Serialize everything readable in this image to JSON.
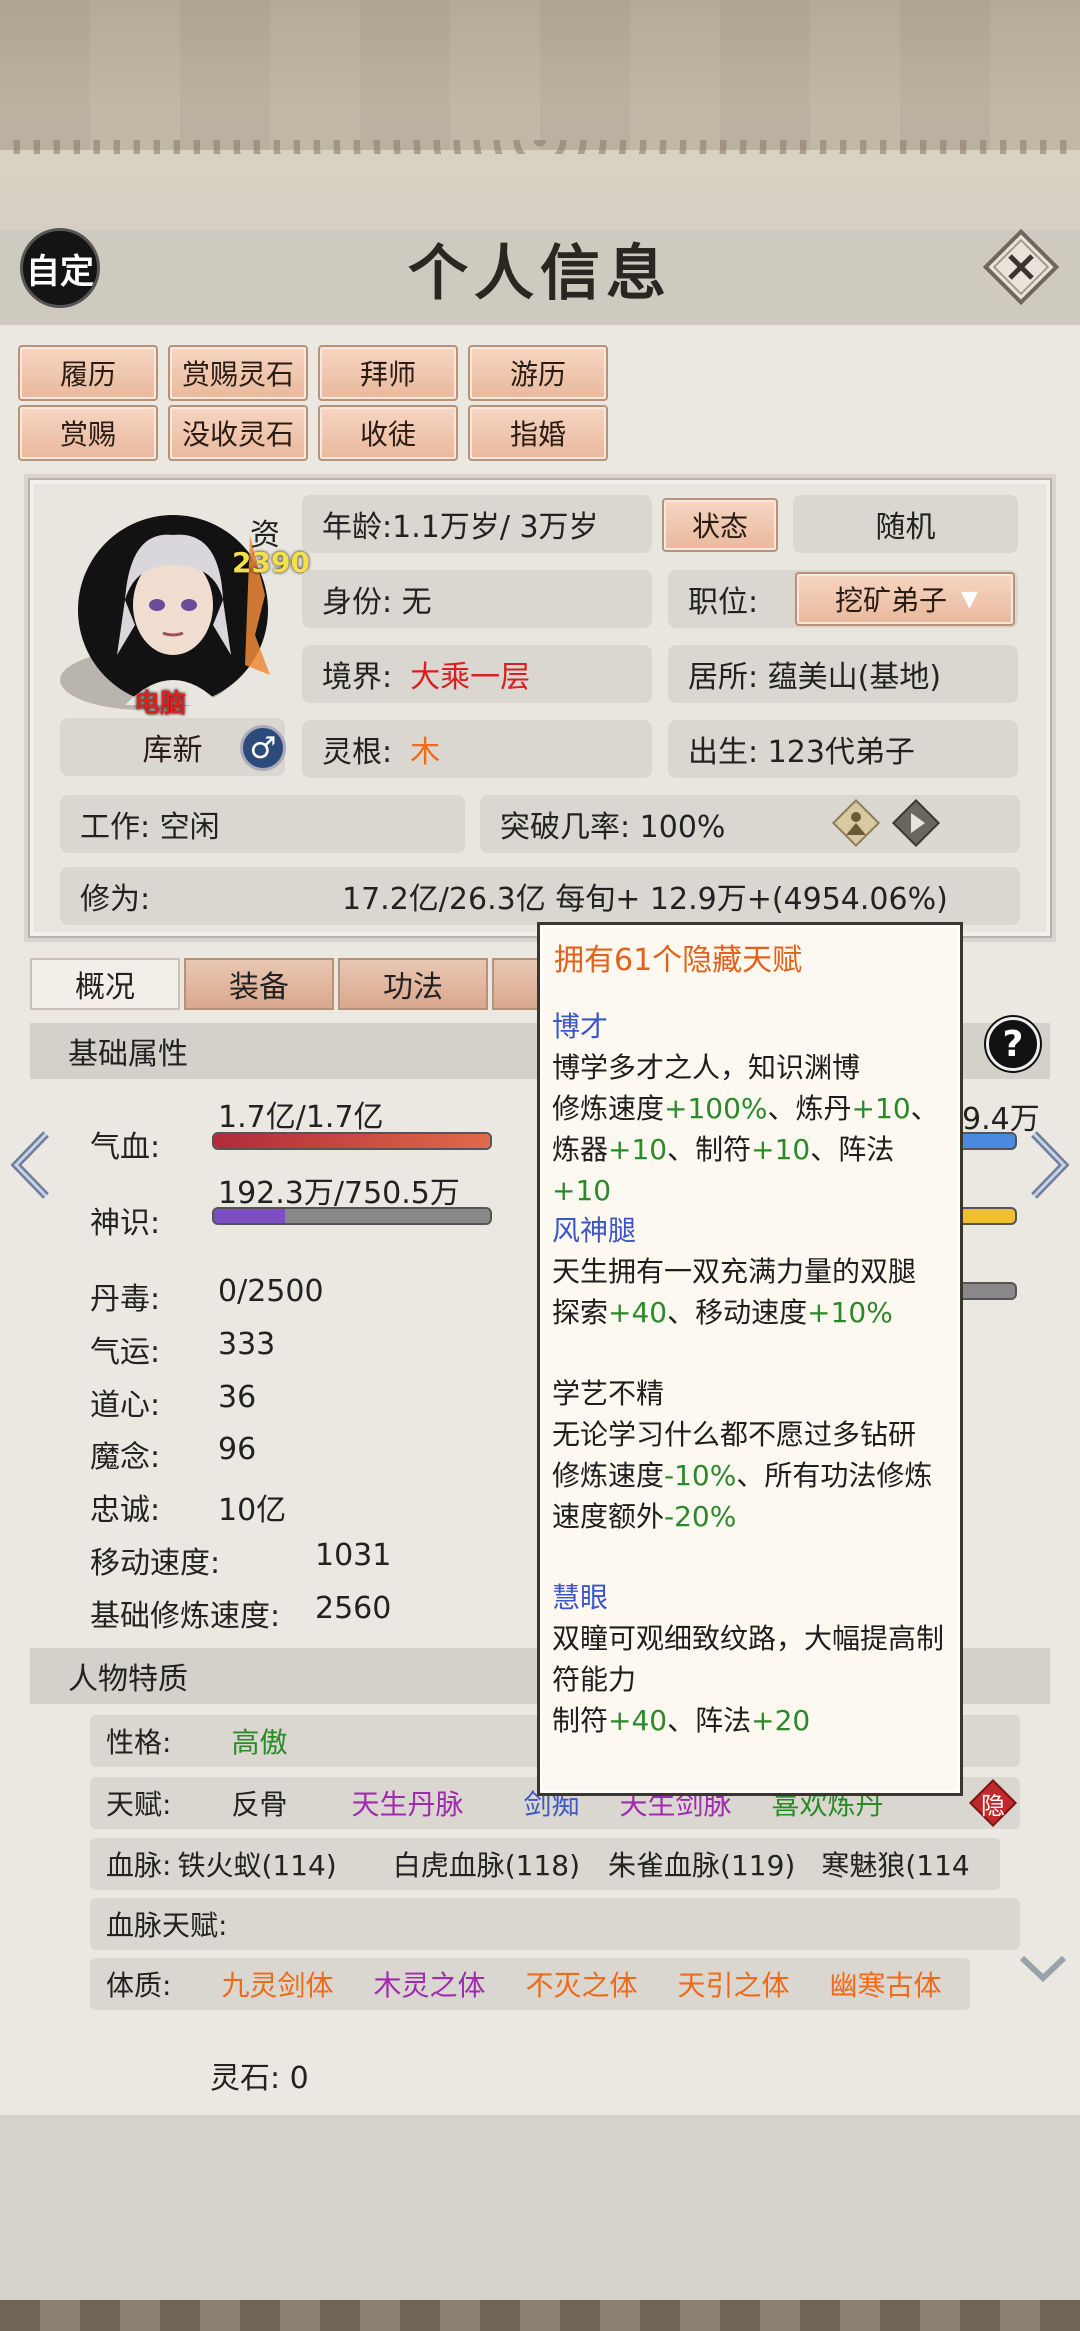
{
  "header": {
    "title": "个人信息",
    "self_label": "自定"
  },
  "actions": {
    "row1": [
      "履历",
      "赏赐灵石",
      "拜师",
      "游历"
    ],
    "row2": [
      "赏赐",
      "没收灵石",
      "收徒",
      "指婚"
    ]
  },
  "profile": {
    "aptitude_label": "资",
    "aptitude_value": "2390",
    "tag": "电脑",
    "name": "库新",
    "age": "年龄:1.1万岁/ 3万岁",
    "status_btn": "状态",
    "random_btn": "随机",
    "identity": "身份:  无",
    "position_label": "职位:",
    "position_value": "挖矿弟子",
    "realm_label": "境界:",
    "realm_value": "大乘一层",
    "residence": "居所: 蕴美山(基地)",
    "root_label": "灵根:",
    "root_value": "木",
    "birth": "出生:  123代弟子",
    "work": "工作: 空闲",
    "breakthrough": "突破几率:  100%",
    "cultivation_label": "修为:",
    "cultivation_value": "17.2亿/26.3亿   每旬+  12.9万+(4954.06%)"
  },
  "tabs": [
    "概况",
    "装备",
    "功法"
  ],
  "basic": {
    "heading": "基础属性",
    "hp_label": "气血:",
    "hp_value": "1.7亿/1.7亿",
    "hp_ratio": 1.0,
    "sense_label": "神识:",
    "sense_value": "192.3万/750.5万",
    "sense_ratio": 0.256,
    "right_value_partial": "9.4万",
    "stats": [
      {
        "label": "丹毒:",
        "value": "0/2500"
      },
      {
        "label": "气运:",
        "value": "333"
      },
      {
        "label": "道心:",
        "value": "36"
      },
      {
        "label": "魔念:",
        "value": "96"
      },
      {
        "label": "忠诚:",
        "value": "10亿"
      },
      {
        "label": "移动速度:",
        "value": "1031"
      },
      {
        "label": "基础修炼速度:",
        "value": "2560"
      }
    ]
  },
  "traits": {
    "heading": "人物特质",
    "personality_label": "性格:",
    "personality_value": "高傲",
    "talent_label": "天赋:",
    "talents": [
      "反骨",
      "天生丹脉",
      "剑痴",
      "天生剑脉",
      "喜欢炼丹"
    ],
    "hidden_label": "隐",
    "bloodline_label": "血脉:",
    "bloodlines": [
      "铁火蚁(114)",
      "白虎血脉(118)",
      "朱雀血脉(119)",
      "寒魅狼(114"
    ],
    "bloodline_talent_label": "血脉天赋:",
    "physique_label": "体质:",
    "physiques": [
      "九灵剑体",
      "木灵之体",
      "不灭之体",
      "天引之体",
      "幽寒古体"
    ]
  },
  "spirit_stone": "灵石:  0",
  "popup": {
    "title": "拥有61个隐藏天赋",
    "items": [
      {
        "name": "博才",
        "desc": "博学多才之人，知识渊博",
        "effects": [
          [
            "修炼速度",
            "+100%"
          ],
          [
            "、炼丹",
            "+10"
          ],
          [
            "、",
            ""
          ],
          [
            "炼器",
            "+10"
          ],
          [
            "、制符",
            "+10"
          ],
          [
            "、阵法",
            "+10"
          ]
        ]
      },
      {
        "name": "风神腿",
        "desc": "天生拥有一双充满力量的双腿",
        "effects": [
          [
            "探索",
            "+40"
          ],
          [
            "、移动速度",
            "+10%"
          ]
        ]
      },
      {
        "name": "学艺不精",
        "desc": "无论学习什么都不愿过多钻研",
        "effects": [
          [
            "修炼速度",
            "-10%"
          ],
          [
            "、所有功法修炼速度额外",
            "-20%"
          ]
        ]
      },
      {
        "name": "慧眼",
        "desc": "双瞳可观细致纹路，大幅提高制符能力",
        "effects": [
          [
            "制符",
            "+40"
          ],
          [
            "、阵法",
            "+20"
          ]
        ]
      }
    ]
  },
  "colors": {
    "accent_btn": "#e9b89c",
    "hp_bar": "#c53535",
    "sense_bar": "#7d4fc2",
    "realm_red": "#d92020"
  }
}
